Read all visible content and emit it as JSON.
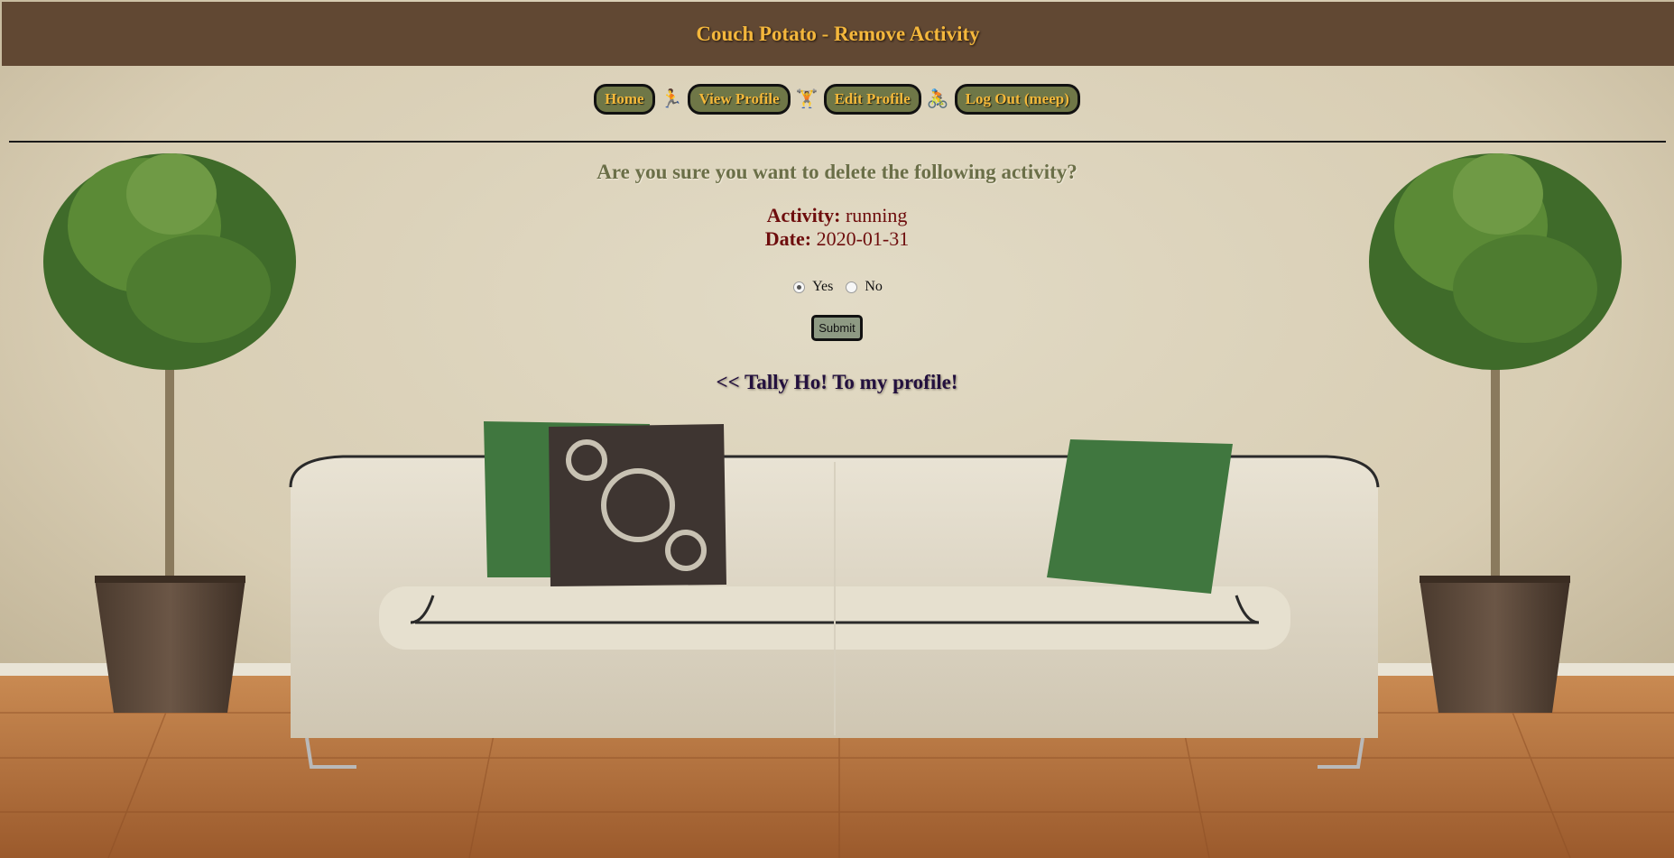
{
  "header": {
    "title": "Couch Potato - Remove Activity"
  },
  "nav": {
    "items": [
      {
        "label": "Home",
        "icon": "running-person-icon",
        "glyph": "🏃"
      },
      {
        "label": "View Profile",
        "icon": "weightlifter-icon",
        "glyph": "🏋"
      },
      {
        "label": "Edit Profile",
        "icon": "cyclist-icon",
        "glyph": "🚴"
      },
      {
        "label": "Log Out (meep)"
      }
    ]
  },
  "main": {
    "question": "Are you sure you want to delete the following activity?",
    "activity_label": "Activity:",
    "activity_value": "running",
    "date_label": "Date:",
    "date_value": "2020-01-31",
    "options": {
      "yes": "Yes",
      "no": "No",
      "selected": "Yes"
    },
    "submit_label": "Submit",
    "back_link": "<< Tally Ho! To my profile!"
  },
  "colors": {
    "header_bg": "#614833",
    "accent_gold": "#f4b73c",
    "button_bg": "#6f7747",
    "question_text": "#6b6f48",
    "detail_text": "#6e0d0d",
    "link_text": "#23103e"
  }
}
